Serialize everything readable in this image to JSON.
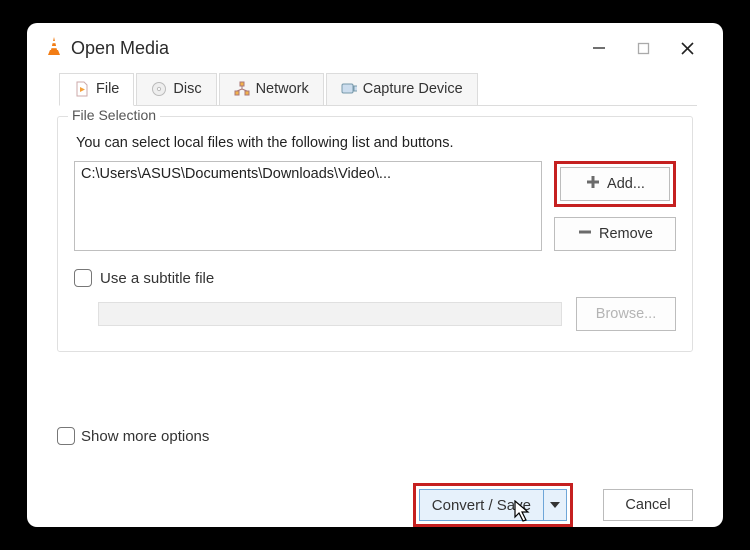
{
  "window": {
    "title": "Open Media"
  },
  "tabs": {
    "file": "File",
    "disc": "Disc",
    "network": "Network",
    "capture": "Capture Device"
  },
  "fileSelection": {
    "legend": "File Selection",
    "hint": "You can select local files with the following list and buttons.",
    "paths": [
      "C:\\Users\\ASUS\\Documents\\Downloads\\Video\\..."
    ],
    "add_label": "Add...",
    "remove_label": "Remove",
    "subtitle_label": "Use a subtitle file",
    "browse_label": "Browse..."
  },
  "footer": {
    "more_options_label": "Show more options",
    "convert_label": "Convert / Save",
    "cancel_label": "Cancel"
  }
}
